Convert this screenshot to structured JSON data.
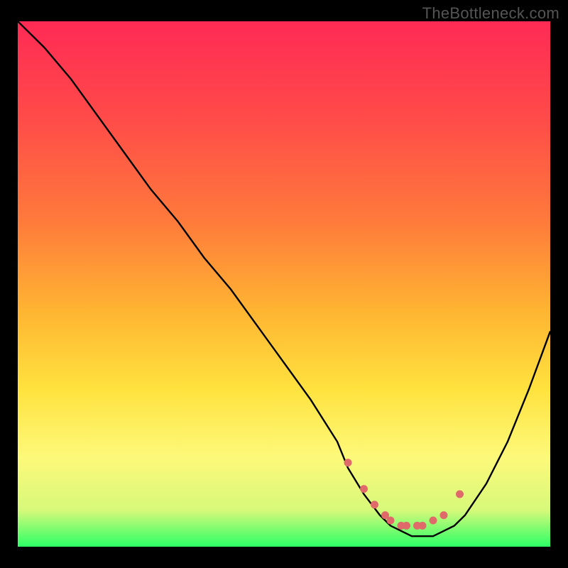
{
  "watermark": "TheBottleneck.com",
  "chart_data": {
    "type": "line",
    "title": "",
    "xlabel": "",
    "ylabel": "",
    "xlim": [
      0,
      100
    ],
    "ylim": [
      0,
      100
    ],
    "grid": false,
    "series": [
      {
        "name": "curve",
        "color": "#000000",
        "x": [
          0,
          5,
          10,
          15,
          20,
          25,
          30,
          35,
          40,
          45,
          50,
          55,
          60,
          62,
          65,
          68,
          70,
          72,
          74,
          76,
          78,
          80,
          82,
          84,
          88,
          92,
          96,
          100
        ],
        "y": [
          100,
          95,
          89,
          82,
          75,
          68,
          62,
          55,
          49,
          42,
          35,
          28,
          20,
          15,
          10,
          6,
          4,
          3,
          2,
          2,
          2,
          3,
          4,
          6,
          12,
          20,
          30,
          41
        ]
      }
    ],
    "markers": {
      "name": "trough-markers",
      "color": "#e06a6a",
      "x": [
        62,
        65,
        67,
        69,
        70,
        72,
        73,
        75,
        76,
        78,
        80,
        83
      ],
      "y": [
        16,
        11,
        8,
        6,
        5,
        4,
        4,
        4,
        4,
        5,
        6,
        10
      ]
    },
    "gradient_stops": [
      {
        "offset": 0,
        "color": "#ff2a55"
      },
      {
        "offset": 18,
        "color": "#ff4a49"
      },
      {
        "offset": 38,
        "color": "#ff7a3b"
      },
      {
        "offset": 55,
        "color": "#ffb432"
      },
      {
        "offset": 70,
        "color": "#ffe23e"
      },
      {
        "offset": 83,
        "color": "#fdf97a"
      },
      {
        "offset": 93,
        "color": "#d7f97a"
      },
      {
        "offset": 100,
        "color": "#2cff66"
      }
    ]
  }
}
